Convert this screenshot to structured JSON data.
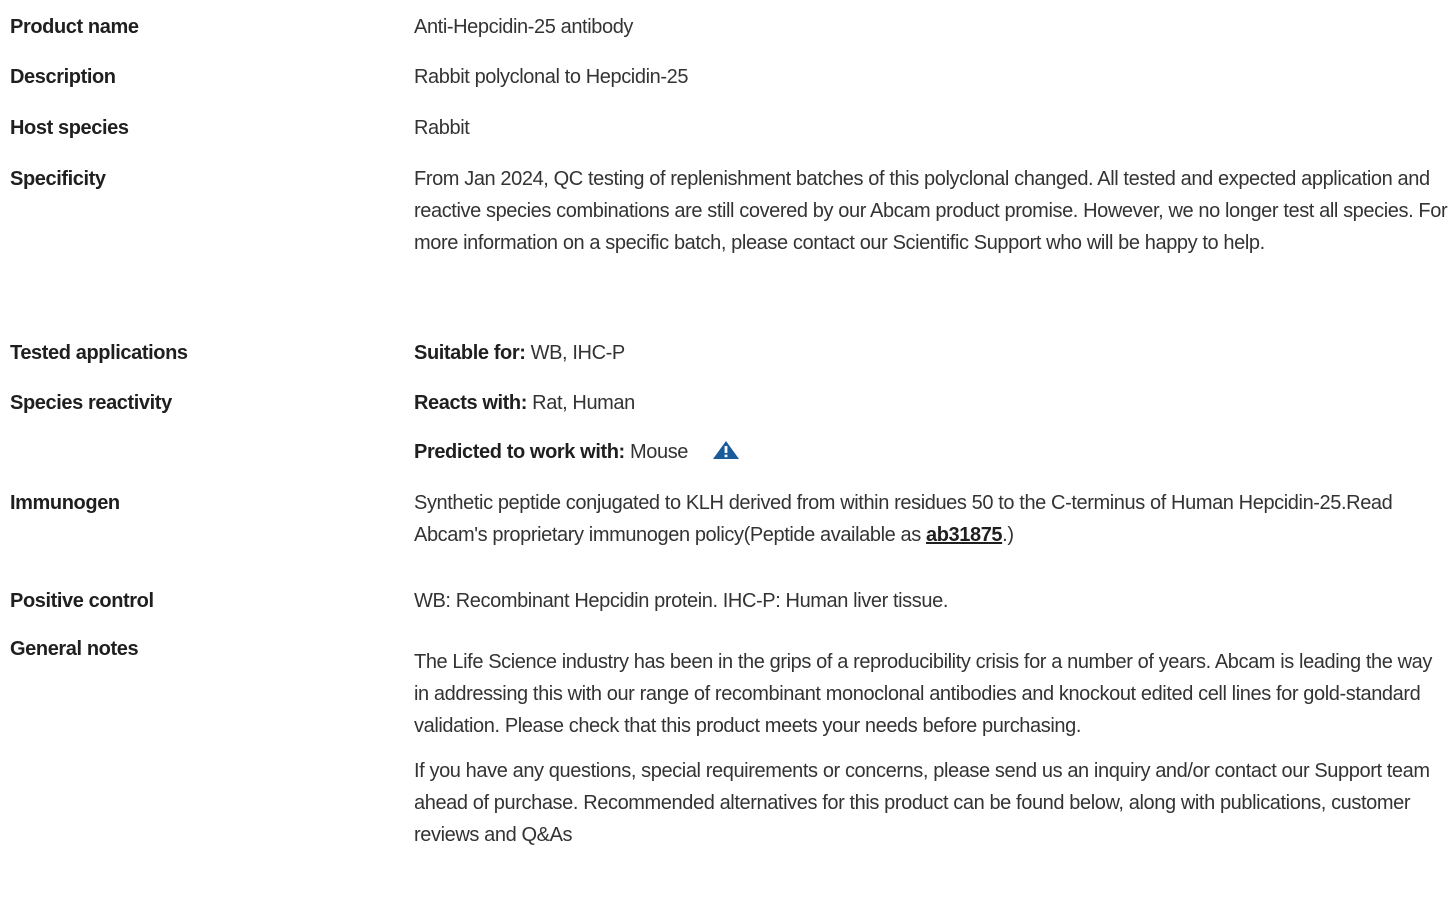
{
  "rows": {
    "product_name": {
      "label": "Product name",
      "value": "Anti-Hepcidin-25 antibody"
    },
    "description": {
      "label": "Description",
      "value": "Rabbit polyclonal to Hepcidin-25"
    },
    "host_species": {
      "label": "Host species",
      "value": "Rabbit"
    },
    "specificity": {
      "label": "Specificity",
      "value": "From Jan 2024, QC testing of replenishment batches of this polyclonal changed. All tested and expected application and reactive species combinations are still covered by our Abcam product promise. However, we no longer test all species. For more information on a specific batch, please contact our Scientific Support who will be happy to help."
    },
    "tested_applications": {
      "label": "Tested applications",
      "lead": "Suitable for:",
      "value": " WB, IHC-P"
    },
    "species_reactivity": {
      "label": "Species reactivity",
      "reacts_lead": "Reacts with:",
      "reacts_value": " Rat, Human",
      "predicted_lead": "Predicted to work with:",
      "predicted_value": " Mouse",
      "predicted_icon": "warning-triangle-icon"
    },
    "immunogen": {
      "label": "Immunogen",
      "text_before": "Synthetic peptide conjugated to KLH derived from within residues 50 to the C-terminus of Human Hepcidin-25.Read Abcam's proprietary immunogen policy(Peptide available as ",
      "link": "ab31875",
      "text_after": ".)"
    },
    "positive_control": {
      "label": "Positive control",
      "value": "WB: Recombinant Hepcidin protein. IHC-P: Human liver tissue."
    },
    "general_notes": {
      "label": "General notes",
      "para1": "The Life Science industry has been in the grips of a reproducibility crisis for a number of years. Abcam is leading the way in addressing this with our range of recombinant monoclonal antibodies and knockout edited cell lines for gold-standard validation. Please check that this product meets your needs before purchasing.",
      "para2": "If you have any questions, special requirements or concerns, please send us an inquiry and/or contact our Support team ahead of purchase. Recommended alternatives for this product can be found below, along with publications, customer reviews and Q&As"
    }
  },
  "colors": {
    "text": "#333333",
    "label": "#1f1f1f",
    "icon": "#1a5b9c"
  }
}
